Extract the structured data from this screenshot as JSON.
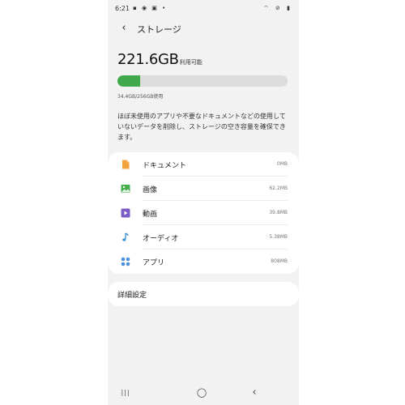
{
  "status": {
    "time": "6:21",
    "left_icons": "▪ ◉ ▣ •",
    "right_icons": "⌔ ⊘ ▮"
  },
  "appbar": {
    "back_icon": "‹",
    "title": "ストレージ"
  },
  "storage": {
    "available": "221.6GB",
    "available_label": "利用可能",
    "used_fraction": 0.134,
    "used_text": "34.4GB/256GB使用",
    "bar_color": "#3fa94b",
    "bar_track_color": "#dcdcdc"
  },
  "description": "ほぼ未使用のアプリや不要なドキュメントなどの使用していないデータを削除し、ストレージの空き容量を確保できます。",
  "categories": [
    {
      "label": "ドキュメント",
      "size": "0MB",
      "icon": "document-icon",
      "color": "#f4a23b"
    },
    {
      "label": "画像",
      "size": "62.2MB",
      "icon": "image-icon",
      "color": "#46b04f"
    },
    {
      "label": "動画",
      "size": "39.8MB",
      "icon": "video-icon",
      "color": "#7b5cc7"
    },
    {
      "label": "オーディオ",
      "size": "5.38MB",
      "icon": "music-icon",
      "color": "#2f8fd8"
    },
    {
      "label": "アプリ",
      "size": "808MB",
      "icon": "apps-icon",
      "color": "#4f8fd8"
    }
  ],
  "advanced": {
    "label": "詳細設定"
  },
  "navbar": {
    "recent_icon": "|||",
    "home_icon": "◯",
    "back_icon": "‹"
  }
}
